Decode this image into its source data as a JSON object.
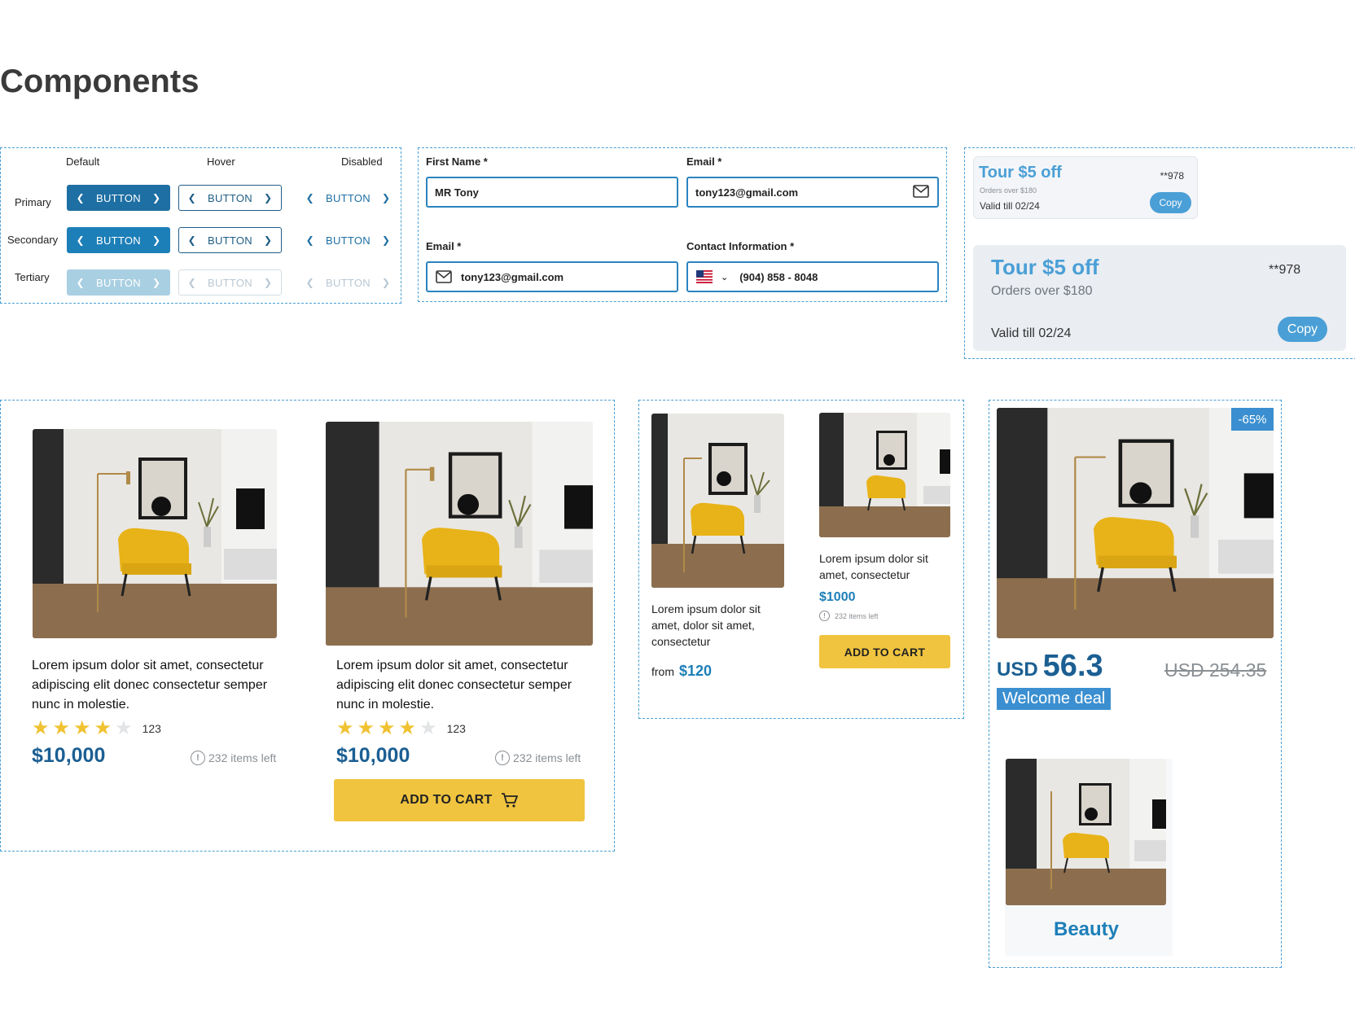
{
  "page": {
    "title": "Components"
  },
  "buttons": {
    "columns": [
      "Default",
      "Hover",
      "Disabled"
    ],
    "rows": [
      "Primary",
      "Secondary",
      "Tertiary"
    ],
    "label": "BUTTON",
    "prev_icon": "chevron-left-icon",
    "next_icon": "chevron-right-icon"
  },
  "form": {
    "first_name": {
      "label": "First Name *",
      "value": "MR Tony"
    },
    "email_top": {
      "label": "Email *",
      "value": "tony123@gmail.com",
      "icon": "mail-icon"
    },
    "email_bottom": {
      "label": "Email *",
      "value": "tony123@gmail.com",
      "icon": "mail-icon"
    },
    "contact": {
      "label": "Contact Information *",
      "value": "(904) 858 - 8048",
      "flag": "us-flag-icon"
    }
  },
  "coupon_small": {
    "title": "Tour $5 off",
    "code": "**978",
    "subtitle": "Orders over $180",
    "valid": "Valid till 02/24",
    "button": "Copy"
  },
  "coupon_large": {
    "title": "Tour $5 off",
    "code": "**978",
    "subtitle": "Orders over $180",
    "valid": "Valid till 02/24",
    "button": "Copy"
  },
  "product_cards": [
    {
      "description": "Lorem ipsum dolor sit amet, consectetur adipiscing elit donec consectetur semper nunc in molestie.",
      "rating": 4,
      "reviews": "123",
      "price": "$10,000",
      "stock": "232 items left"
    },
    {
      "description": "Lorem ipsum dolor sit amet, consectetur adipiscing elit donec consectetur semper nunc in molestie.",
      "rating": 4,
      "reviews": "123",
      "price": "$10,000",
      "stock": "232 items left",
      "button": "ADD TO CART"
    }
  ],
  "small_cards": [
    {
      "description": "Lorem ipsum dolor sit amet,  dolor sit amet, consectetur",
      "from": "from",
      "price": "$120"
    },
    {
      "description": "Lorem ipsum dolor sit amet, consectetur",
      "price": "$1000",
      "stock": "232 items left",
      "button": "ADD TO CART"
    }
  ],
  "deal_card": {
    "discount": "-65%",
    "currency": "USD",
    "price": "56.3",
    "old_price": "USD 254.35",
    "tag": "Welcome deal"
  },
  "category_card": {
    "label": "Beauty"
  },
  "colors": {
    "primary": "#1e6fa3",
    "accent_yellow": "#f0c43f",
    "link_blue": "#4a9fd6"
  }
}
